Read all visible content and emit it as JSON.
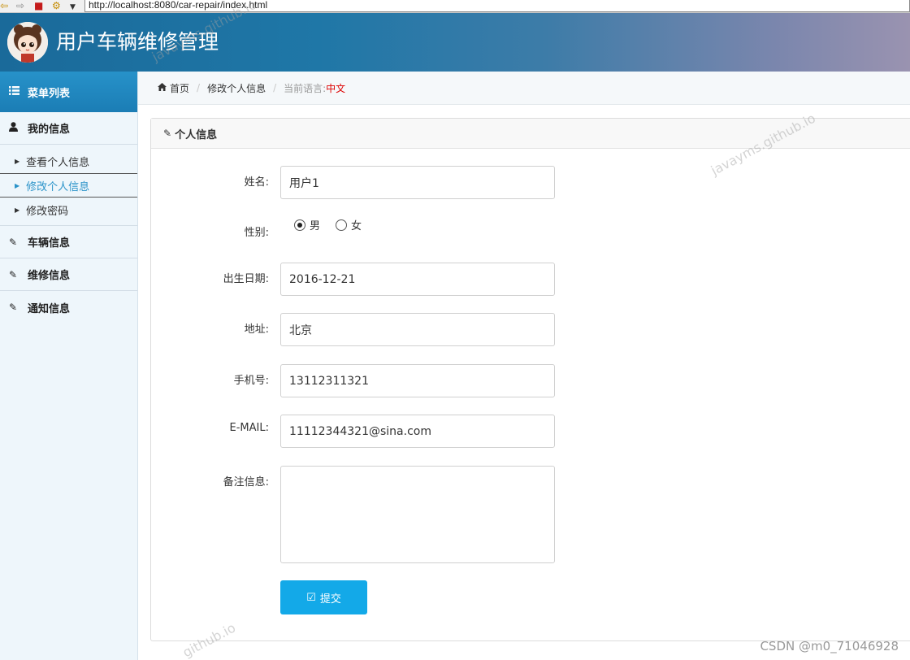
{
  "browser": {
    "url": "http://localhost:8080/car-repair/index.html"
  },
  "header": {
    "title": "用户车辆维修管理"
  },
  "sidebar": {
    "menu_title": "菜单列表",
    "groups": [
      {
        "label": "我的信息",
        "icon": "user-icon"
      },
      {
        "label": "车辆信息",
        "icon": "edit-icon"
      },
      {
        "label": "维修信息",
        "icon": "edit-icon"
      },
      {
        "label": "通知信息",
        "icon": "edit-icon"
      }
    ],
    "my_info_items": [
      {
        "label": "查看个人信息"
      },
      {
        "label": "修改个人信息"
      },
      {
        "label": "修改密码"
      }
    ]
  },
  "breadcrumb": {
    "home": "首页",
    "current": "修改个人信息",
    "lang_label": "当前语言:",
    "lang_value": "中文"
  },
  "panel": {
    "title": "个人信息"
  },
  "form": {
    "name_label": "姓名:",
    "name_value": "用户1",
    "gender_label": "性别:",
    "gender_male": "男",
    "gender_female": "女",
    "birth_label": "出生日期:",
    "birth_value": "2016-12-21",
    "address_label": "地址:",
    "address_value": "北京",
    "phone_label": "手机号:",
    "phone_value": "13112311321",
    "email_label": "E-MAIL:",
    "email_value": "11112344321@sina.com",
    "remark_label": "备注信息:",
    "remark_value": "",
    "submit_label": "提交"
  },
  "watermarks": {
    "a": "javayms.github.io",
    "b": "javayms.github.io",
    "c": "github.io"
  },
  "footer": {
    "csdn": "CSDN @m0_71046928"
  }
}
